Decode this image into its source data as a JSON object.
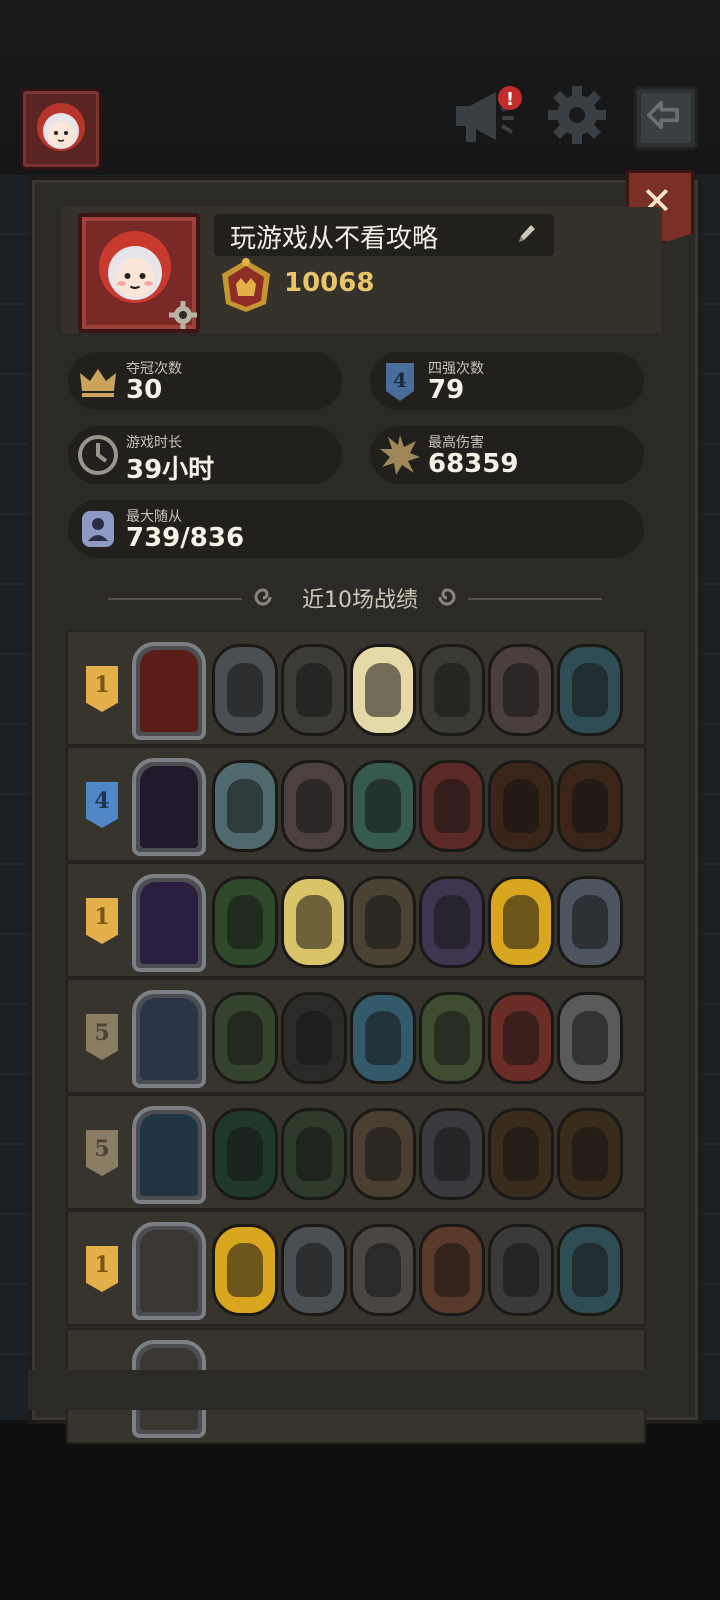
{
  "topbar": {
    "avatar_icon": "hooded-girl-avatar-icon",
    "announcement_icon": "megaphone-icon",
    "settings_icon": "gear-icon",
    "back_icon": "back-arrow-icon"
  },
  "profile": {
    "name": "玩游戏从不看攻略",
    "score": "10068",
    "rank_icon": "crown-rank-icon"
  },
  "stats": [
    {
      "label": "夺冠次数",
      "value": "30",
      "icon": "crown-icon"
    },
    {
      "label": "四强次数",
      "value": "79",
      "icon": "top4-shield-icon"
    },
    {
      "label": "游戏时长",
      "value": "39小时",
      "icon": "clock-icon"
    },
    {
      "label": "最高伤害",
      "value": "68359",
      "icon": "damage-burst-icon"
    },
    {
      "label": "最大随从",
      "value": "739/836",
      "icon": "minion-portrait-icon"
    }
  ],
  "section": {
    "title": "近10场战绩"
  },
  "matches": [
    {
      "placement": "1",
      "badge_color": "#e3b04a",
      "hero_color": "#5a1e17",
      "minions": [
        "#4c4f52",
        "#3d3b36",
        "#e6d9a8",
        "#3a3a32",
        "#4a3f3c",
        "#2f4d55"
      ]
    },
    {
      "placement": "4",
      "badge_color": "#4f88c4",
      "hero_color": "#221a2c",
      "minions": [
        "#4e6a6e",
        "#4c4140",
        "#355a4e",
        "#5b2a26",
        "#3a2518",
        "#3a2518"
      ]
    },
    {
      "placement": "1",
      "badge_color": "#e3b04a",
      "hero_color": "#2a1f40",
      "minions": [
        "#2e4a2a",
        "#d9c46a",
        "#4a4334",
        "#3f3550",
        "#d9a620",
        "#4d5560"
      ]
    },
    {
      "placement": "5",
      "badge_color": "#8a7d64",
      "hero_color": "#2c3448",
      "minions": [
        "#35442e",
        "#2a2a28",
        "#335a6a",
        "#3e4d30",
        "#6a2e26",
        "#5a5a5a"
      ]
    },
    {
      "placement": "5",
      "badge_color": "#8a7d64",
      "hero_color": "#203646",
      "minions": [
        "#1f3a2a",
        "#2e3a2a",
        "#4a3f30",
        "#3a3a3e",
        "#3a2c1a",
        "#3a2c1a"
      ]
    },
    {
      "placement": "1",
      "badge_color": "#e3b04a",
      "hero_color": "#3a3632",
      "minions": [
        "#d9a620",
        "#4c4f52",
        "#4a4642",
        "#5a3a2a",
        "#3a3a3a",
        "#2f4d55"
      ]
    }
  ]
}
